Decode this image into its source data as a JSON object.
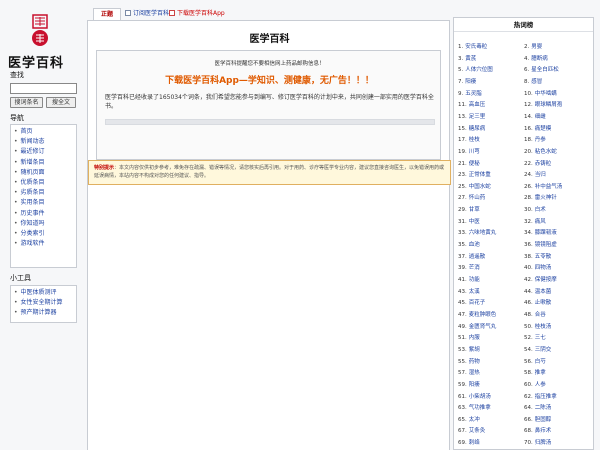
{
  "site": {
    "logo_text": "医学百科",
    "search_heading": "查找",
    "search_placeholder": "",
    "search_button": "搜词条名",
    "fulltext_button": "搜全文",
    "nav_heading": "导航",
    "nav_items": [
      "首页",
      "新闻动态",
      "最近修订",
      "新增条目",
      "随机页面",
      "优质条目",
      "劣质条目",
      "实用条目",
      "历史事件",
      "你知道吗",
      "分类索引",
      "游戏软件"
    ],
    "tools_heading": "小工具",
    "tool_items": [
      "中医体质测评",
      "女性安全期计算",
      "预产期计算器"
    ]
  },
  "tabs": {
    "active": "正题",
    "subscribe": "订阅医学百科",
    "download": "下载医学百科App"
  },
  "main": {
    "page_title": "医学百科",
    "notice_small": "医学百科提醒您不要相信网上药品邮购信息！",
    "app_promo": "下载医学百科App—学知识、测健康，无广告！！！",
    "intro": "医学百科已经收录了165034个词条，我们希望您能参与到编写、修订医学百科的计划中来，共同创建一部实用的医学百科全书。",
    "warning_label": "特别提示",
    "warning_text": "：本文内容仅供初步参考，难免存在疏漏、错误等情况，请您核实后再引用。对于用药、诊疗等医学专业内容，建议您直接咨询医生，以免错误用药或延误病情，本站内容不构成对您的任何建议、指导。"
  },
  "hot": {
    "title": "热词榜",
    "items": [
      [
        "1.",
        "安氏毒粒",
        "2.",
        "男婴"
      ],
      [
        "3.",
        "黄芪",
        "4.",
        "臆断病"
      ],
      [
        "5.",
        "人体穴位图",
        "6.",
        "星全白匹松"
      ],
      [
        "7.",
        "阳痿",
        "8.",
        "感冒"
      ],
      [
        "9.",
        "五灵脂",
        "10.",
        "中华啮螨"
      ],
      [
        "11.",
        "高血压",
        "12.",
        "眼球鳞屑孢"
      ],
      [
        "13.",
        "足三里",
        "14.",
        "细雌"
      ],
      [
        "15.",
        "糖尿病",
        "16.",
        "痛楚模"
      ],
      [
        "17.",
        "桂枝",
        "18.",
        "丹参"
      ],
      [
        "19.",
        "川芎",
        "20.",
        "粘色水蛇"
      ],
      [
        "21.",
        "便秘",
        "22.",
        "赤铸粒"
      ],
      [
        "23.",
        "正常体重",
        "24.",
        "当归"
      ],
      [
        "25.",
        "中国水蛇",
        "26.",
        "补中益气汤"
      ],
      [
        "27.",
        "怀山药",
        "28.",
        "雷火神针"
      ],
      [
        "29.",
        "甘草",
        "30.",
        "白术"
      ],
      [
        "31.",
        "中医",
        "32.",
        "痛风"
      ],
      [
        "33.",
        "六味地黄丸",
        "34.",
        "膝踝韧液"
      ],
      [
        "35.",
        "血池",
        "36.",
        "镜镜阻虚"
      ],
      [
        "37.",
        "逍遥散",
        "38.",
        "五苓散"
      ],
      [
        "39.",
        "芒消",
        "40.",
        "四物汤"
      ],
      [
        "41.",
        "功能",
        "42.",
        "保健按摩"
      ],
      [
        "43.",
        "太溪",
        "44.",
        "温本菌"
      ],
      [
        "45.",
        "百花子",
        "46.",
        "止嗽散"
      ],
      [
        "47.",
        "麦粒肿眼色",
        "48.",
        "合谷"
      ],
      [
        "49.",
        "金匮肾气丸",
        "50.",
        "桂枝汤"
      ],
      [
        "51.",
        "内服",
        "52.",
        "三七"
      ],
      [
        "53.",
        "紫胡",
        "54.",
        "三阴交"
      ],
      [
        "55.",
        "药物",
        "56.",
        "白芍"
      ],
      [
        "57.",
        "湿热",
        "58.",
        "推拿"
      ],
      [
        "59.",
        "阳痿",
        "60.",
        "人参"
      ],
      [
        "61.",
        "小柴胡汤",
        "62.",
        "指压推拿"
      ],
      [
        "63.",
        "气功推拿",
        "64.",
        "二陈汤"
      ],
      [
        "65.",
        "太冲",
        "66.",
        "胆固醇"
      ],
      [
        "67.",
        "艾条灸",
        "68.",
        "鼻疖术"
      ],
      [
        "69.",
        "刺络",
        "70.",
        "归脾汤"
      ]
    ]
  }
}
